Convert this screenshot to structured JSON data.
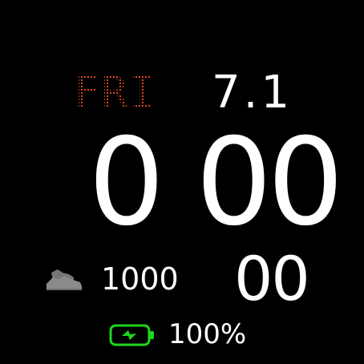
{
  "watch": {
    "day": "FRI",
    "date": "7.1",
    "hour": "0",
    "minute": "00",
    "seconds": "00",
    "steps": "1000",
    "battery": "100%"
  },
  "icons": {
    "steps": "shoe-icon",
    "battery": "battery-charging-icon"
  },
  "colors": {
    "background": "#000000",
    "day_accent": "#e0451d",
    "text": "#ffffff",
    "battery": "#1ed61e",
    "shoe": "#8a8a8a"
  }
}
